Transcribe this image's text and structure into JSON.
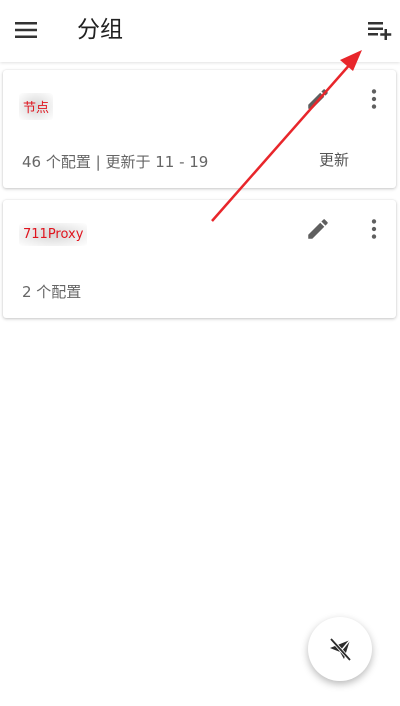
{
  "header": {
    "title": "分组",
    "menu_icon": "menu-icon",
    "add_icon": "playlist-add-icon"
  },
  "groups": [
    {
      "name": "节点",
      "info": "46 个配置 | 更新于 11 - 19",
      "update_label": "更新"
    },
    {
      "name": "711Proxy",
      "info": "2 个配置"
    }
  ],
  "fab": {
    "icon": "airplane-off-icon"
  },
  "colors": {
    "accent_red": "#e0141e",
    "annotation_arrow": "#e8262b",
    "icon_gray": "#5f5f5f"
  }
}
